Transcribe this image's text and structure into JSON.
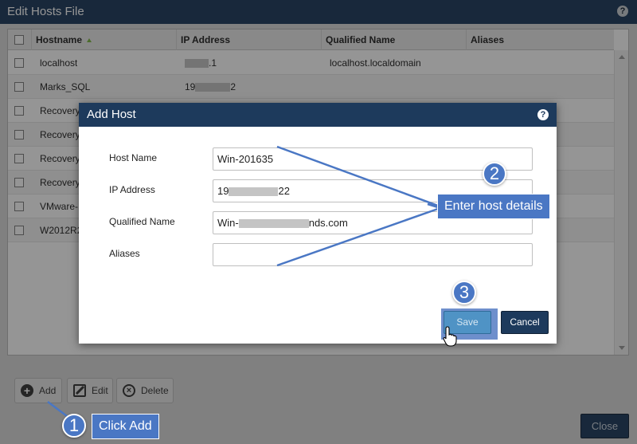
{
  "window": {
    "title": "Edit Hosts File",
    "help_glyph": "?"
  },
  "grid": {
    "columns": [
      "Hostname",
      "IP Address",
      "Qualified Name",
      "Aliases"
    ],
    "rows": [
      {
        "hostname": "localhost",
        "ip": ".1",
        "qualified": "localhost.localdomain"
      },
      {
        "hostname": "Marks_SQL",
        "ip_prefix": "19",
        "ip_suffix": "2",
        "qualified": ""
      },
      {
        "hostname": "Recovery"
      },
      {
        "hostname": "Recovery"
      },
      {
        "hostname": "Recovery"
      },
      {
        "hostname": "Recovery"
      },
      {
        "hostname": "VMware-"
      },
      {
        "hostname": "W2012R2"
      }
    ]
  },
  "toolbar": {
    "add": "Add",
    "edit": "Edit",
    "delete": "Delete",
    "close": "Close"
  },
  "dialog": {
    "title": "Add Host",
    "help_glyph": "?",
    "fields": {
      "host_name": {
        "label": "Host Name",
        "value": "Win-201635"
      },
      "ip_address": {
        "label": "IP Address",
        "value_prefix": "19",
        "value_suffix": "22"
      },
      "qualified_name": {
        "label": "Qualified Name",
        "value_prefix": "Win-",
        "value_suffix": "nds.com"
      },
      "aliases": {
        "label": "Aliases",
        "value": ""
      }
    },
    "save": "Save",
    "cancel": "Cancel"
  },
  "annotations": {
    "step1": {
      "number": "1",
      "text": "Click Add"
    },
    "step2": {
      "number": "2",
      "text": "Enter host details"
    },
    "step3": {
      "number": "3"
    }
  },
  "colors": {
    "header_blue": "#1d3a5c",
    "callout_blue": "#4a77c4",
    "save_blue": "#4f93c5"
  }
}
